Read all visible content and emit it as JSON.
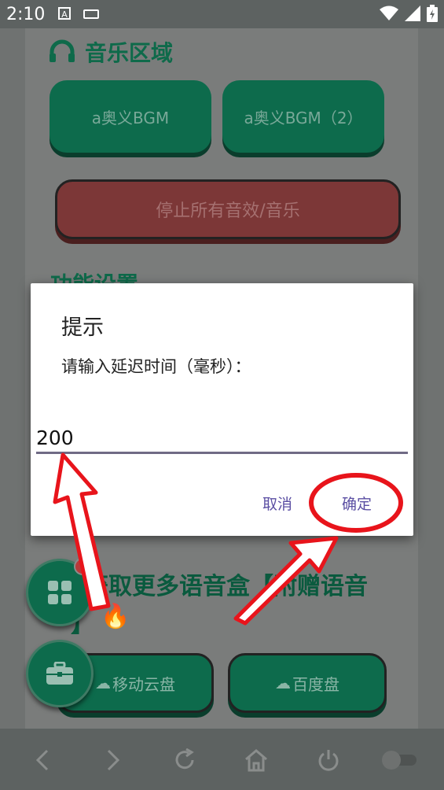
{
  "status_bar": {
    "time": "2:10",
    "a_indicator": "A"
  },
  "background": {
    "music_section_title": "音乐区域",
    "bgm_buttons": [
      "a奥义BGM",
      "a奥义BGM（2）"
    ],
    "stop_button": "停止所有音效/音乐",
    "function_settings_title": "功能设置",
    "more_voice_text_line1": "获取更多语音盒【附赠语音",
    "more_voice_text_line2": "】",
    "cloud_buttons": [
      "移动云盘",
      "百度盘"
    ]
  },
  "dialog": {
    "title": "提示",
    "message": "请输入延迟时间（毫秒）：",
    "input_value": "200",
    "cancel_label": "取消",
    "confirm_label": "确定"
  },
  "colors": {
    "accent_green": "#0d6b4c",
    "annotation_red": "#e8141b",
    "dialog_button": "#5b4fa3"
  },
  "icons": {
    "status": [
      "a-icon",
      "keyboard-icon",
      "wifi-icon",
      "signal-icon",
      "battery-icon"
    ],
    "nav": [
      "back-icon",
      "forward-icon",
      "refresh-icon",
      "home-icon",
      "power-icon",
      "toggle-icon"
    ]
  }
}
